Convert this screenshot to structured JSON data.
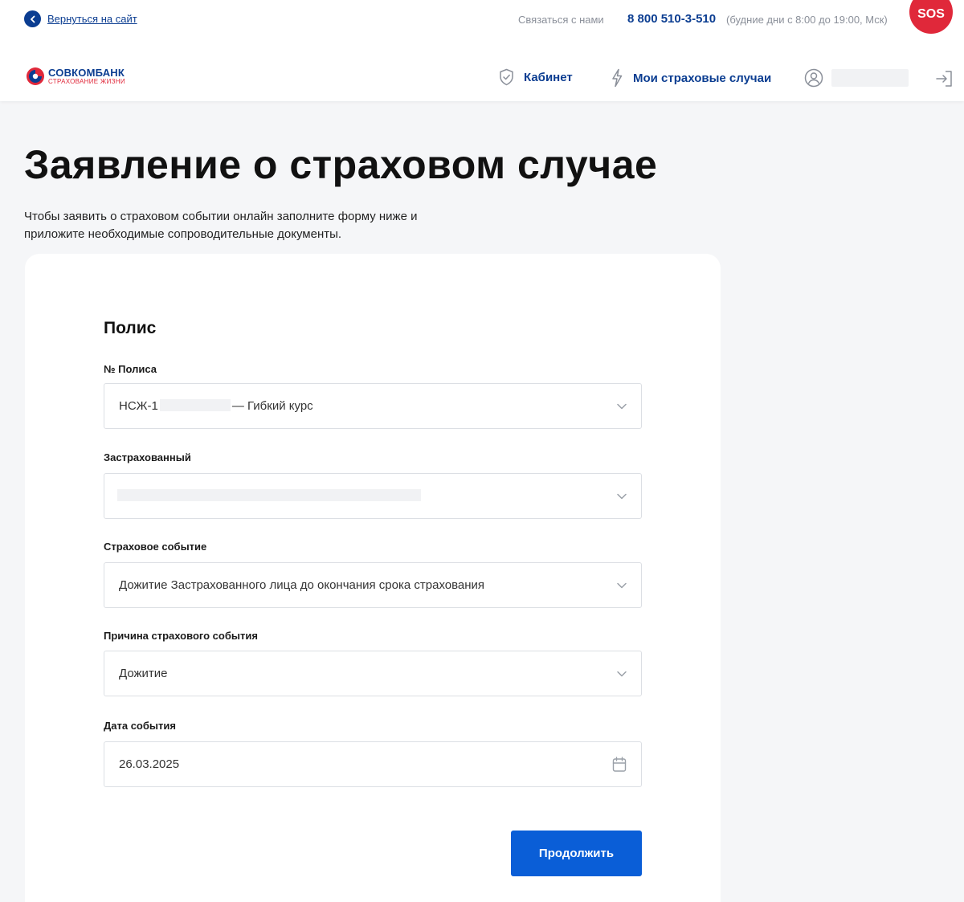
{
  "topbar": {
    "back_label": "Вернуться на сайт",
    "contact_label": "Связаться с нами",
    "phone": "8 800 510-3-510",
    "hours": "(будние дни с 8:00 до 19:00, Мск)",
    "sos_label": "SOS"
  },
  "navbar": {
    "logo_main": "СОВКОМБАНК",
    "logo_sub": "СТРАХОВАНИЕ ЖИЗНИ",
    "cabinet_label": "Кабинет",
    "cases_label": "Мои страховые случаи"
  },
  "page": {
    "title": "Заявление о страховом случае",
    "description": "Чтобы заявить о страховом событии онлайн заполните форму ниже и приложите необходимые сопроводительные документы."
  },
  "form": {
    "section_title": "Полис",
    "policy": {
      "label": "№ Полиса",
      "value_prefix": "НСЖ-1",
      "value_suffix": "— Гибкий курс"
    },
    "insured": {
      "label": "Застрахованный"
    },
    "event": {
      "label": "Страховое событие",
      "value": "Дожитие Застрахованного лица до окончания срока страхования"
    },
    "reason": {
      "label": "Причина страхового события",
      "value": "Дожитие"
    },
    "date": {
      "label": "Дата события",
      "value": "26.03.2025"
    },
    "submit_label": "Продолжить"
  },
  "colors": {
    "brand_blue": "#0b3d91",
    "button_blue": "#0a5ed7",
    "sos_red": "#e0283a",
    "page_bg": "#f5f6f8"
  }
}
